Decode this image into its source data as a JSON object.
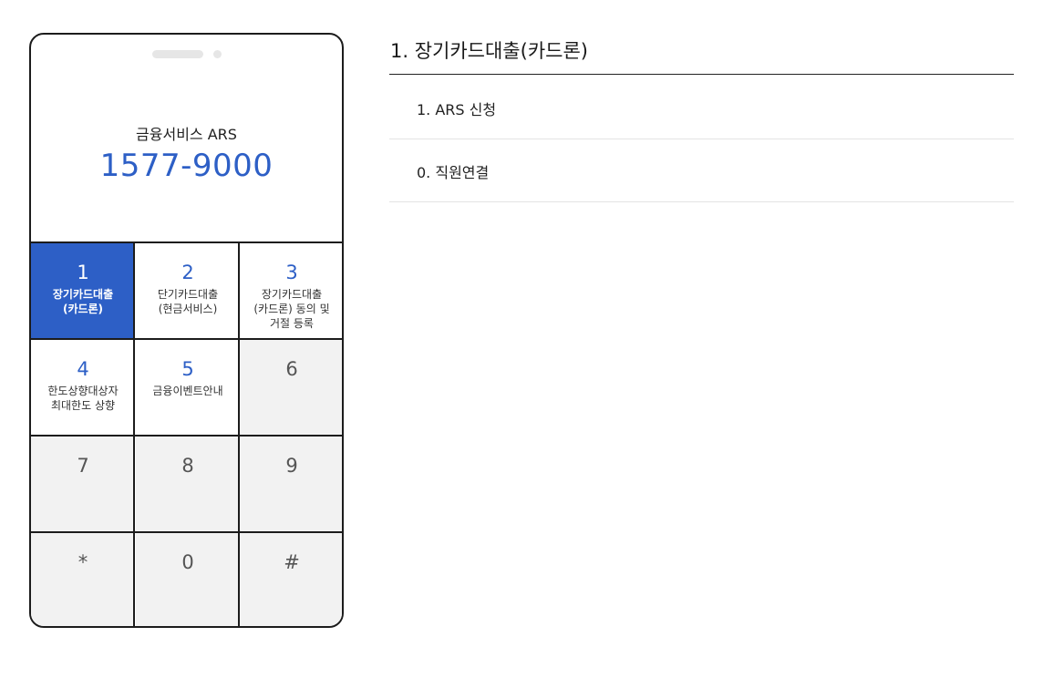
{
  "phone": {
    "service_label": "금융서비스 ARS",
    "service_number": "1577-9000"
  },
  "keypad": {
    "keys": [
      {
        "num": "1",
        "label_line1": "장기카드대출",
        "label_line2": "(카드론)",
        "label_line3": "",
        "state": "active"
      },
      {
        "num": "2",
        "label_line1": "단기카드대출",
        "label_line2": "(현금서비스)",
        "label_line3": "",
        "state": "labeled"
      },
      {
        "num": "3",
        "label_line1": "장기카드대출",
        "label_line2": "(카드론) 동의 및",
        "label_line3": "거절 등록",
        "state": "labeled"
      },
      {
        "num": "4",
        "label_line1": "한도상향대상자",
        "label_line2": "최대한도 상향",
        "label_line3": "",
        "state": "labeled"
      },
      {
        "num": "5",
        "label_line1": "금융이벤트안내",
        "label_line2": "",
        "label_line3": "",
        "state": "labeled"
      },
      {
        "num": "6",
        "label_line1": "",
        "label_line2": "",
        "label_line3": "",
        "state": "empty"
      },
      {
        "num": "7",
        "label_line1": "",
        "label_line2": "",
        "label_line3": "",
        "state": "empty"
      },
      {
        "num": "8",
        "label_line1": "",
        "label_line2": "",
        "label_line3": "",
        "state": "empty"
      },
      {
        "num": "9",
        "label_line1": "",
        "label_line2": "",
        "label_line3": "",
        "state": "empty"
      },
      {
        "num": "*",
        "label_line1": "",
        "label_line2": "",
        "label_line3": "",
        "state": "empty"
      },
      {
        "num": "0",
        "label_line1": "",
        "label_line2": "",
        "label_line3": "",
        "state": "empty"
      },
      {
        "num": "#",
        "label_line1": "",
        "label_line2": "",
        "label_line3": "",
        "state": "empty"
      }
    ]
  },
  "menu": {
    "title": "1. 장기카드대출(카드론)",
    "items": [
      {
        "label": "1. ARS 신청"
      },
      {
        "label": "0. 직원연결"
      }
    ]
  },
  "colors": {
    "accent": "#2d5fc6",
    "border": "#1c1c1c",
    "key_bg": "#f2f2f2"
  }
}
